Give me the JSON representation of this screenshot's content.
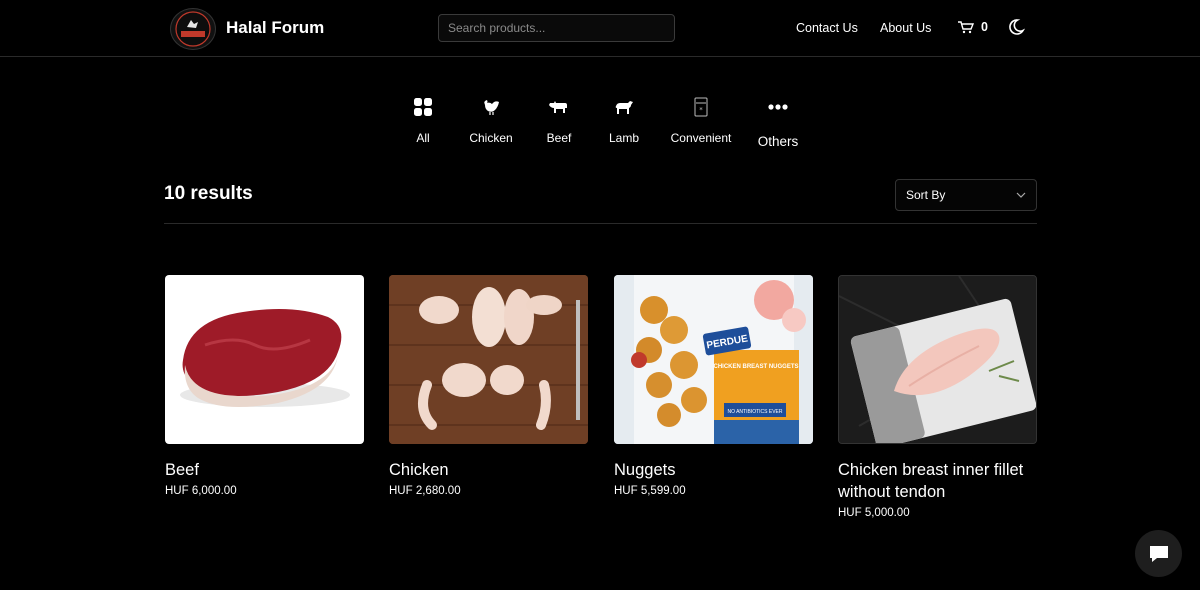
{
  "header": {
    "brand": "Halal Forum",
    "logo_text": "HALAL FORUM",
    "search_placeholder": "Search products...",
    "nav": {
      "contact": "Contact Us",
      "about": "About Us"
    },
    "cart_count": "0"
  },
  "categories": [
    {
      "label": "All",
      "icon": "grid-icon"
    },
    {
      "label": "Chicken",
      "icon": "chicken-icon"
    },
    {
      "label": "Beef",
      "icon": "cow-icon"
    },
    {
      "label": "Lamb",
      "icon": "lamb-icon"
    },
    {
      "label": "Convenient",
      "icon": "freezer-icon"
    },
    {
      "label": "Others",
      "icon": "more-icon"
    }
  ],
  "results": {
    "count_label": "10 results",
    "sort_label": "Sort By"
  },
  "products": [
    {
      "name": "Beef",
      "price": "HUF 6,000.00"
    },
    {
      "name": "Chicken",
      "price": "HUF 2,680.00"
    },
    {
      "name": "Nuggets",
      "price": "HUF 5,599.00",
      "pack_brand": "PERDUE",
      "pack_title": "CHICKEN BREAST NUGGETS",
      "pack_claim": "NO ANTIBIOTICS EVER"
    },
    {
      "name": "Chicken breast inner fillet without tendon",
      "price": "HUF 5,000.00"
    }
  ],
  "colors": {
    "background": "#000000",
    "text": "#ffffff",
    "border": "#2a2a2a"
  }
}
